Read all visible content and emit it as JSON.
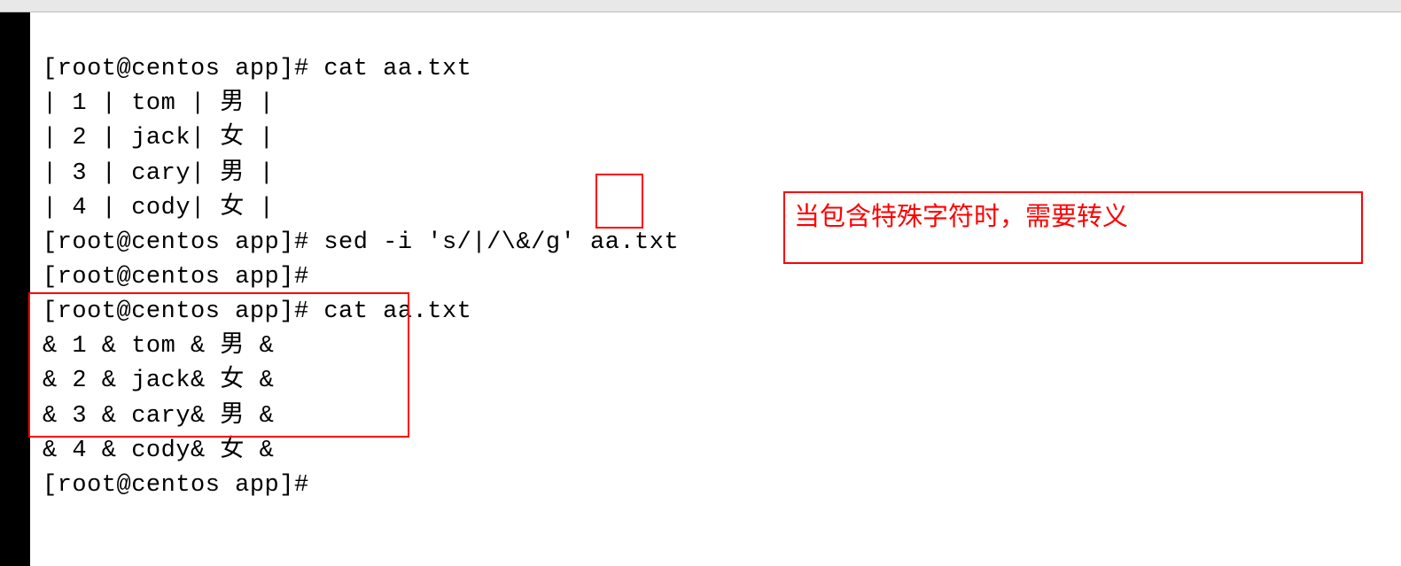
{
  "terminal": {
    "lines": [
      "[root@centos app]# cat aa.txt",
      "| 1 | tom | 男 |",
      "| 2 | jack| 女 |",
      "| 3 | cary| 男 |",
      "| 4 | cody| 女 |",
      "[root@centos app]# sed -i 's/|/\\&/g' aa.txt",
      "[root@centos app]# ",
      "[root@centos app]# cat aa.txt",
      "& 1 & tom & 男 &",
      "& 2 & jack& 女 &",
      "& 3 & cary& 男 &",
      "& 4 & cody& 女 &",
      "[root@centos app]# "
    ]
  },
  "annotations": {
    "comment": "当包含特殊字符时，需要转义"
  }
}
